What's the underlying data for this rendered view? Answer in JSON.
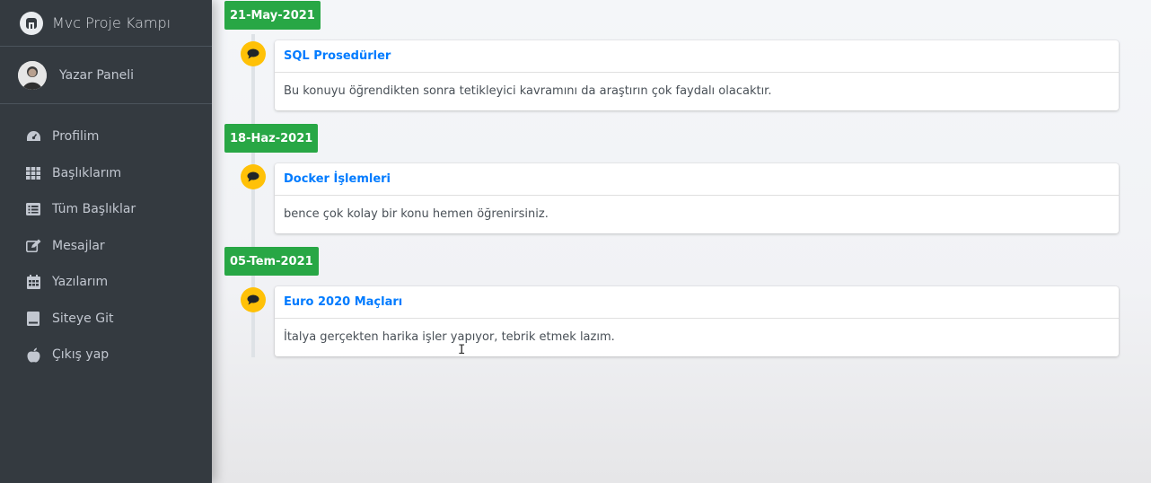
{
  "brand": {
    "title": "Mvc Proje Kampı"
  },
  "user": {
    "name": "Yazar Paneli"
  },
  "sidebar": {
    "items": [
      {
        "label": "Profilim",
        "icon": "dashboard-icon"
      },
      {
        "label": "Başlıklarım",
        "icon": "grid-icon"
      },
      {
        "label": "Tüm Başlıklar",
        "icon": "list-icon"
      },
      {
        "label": "Mesajlar",
        "icon": "edit-icon"
      },
      {
        "label": "Yazılarım",
        "icon": "calendar-icon"
      },
      {
        "label": "Siteye Git",
        "icon": "book-icon"
      },
      {
        "label": "Çıkış yap",
        "icon": "apple-icon"
      }
    ]
  },
  "timeline": [
    {
      "date": "21-May-2021",
      "title": "SQL Prosedürler",
      "body": "Bu konuyu öğrendikten sonra tetikleyici kavramını da araştırın çok faydalı olacaktır."
    },
    {
      "date": "18-Haz-2021",
      "title": "Docker İşlemleri",
      "body": "bence çok kolay bir konu hemen öğrenirsiniz."
    },
    {
      "date": "05-Tem-2021",
      "title": "Euro 2020 Maçları",
      "body": "İtalya gerçekten harika işler yapıyor, tebrik etmek lazım."
    }
  ],
  "colors": {
    "sidebar_bg": "#343a40",
    "date_label": "#28a745",
    "icon_badge": "#ffc107",
    "link": "#007bff"
  }
}
